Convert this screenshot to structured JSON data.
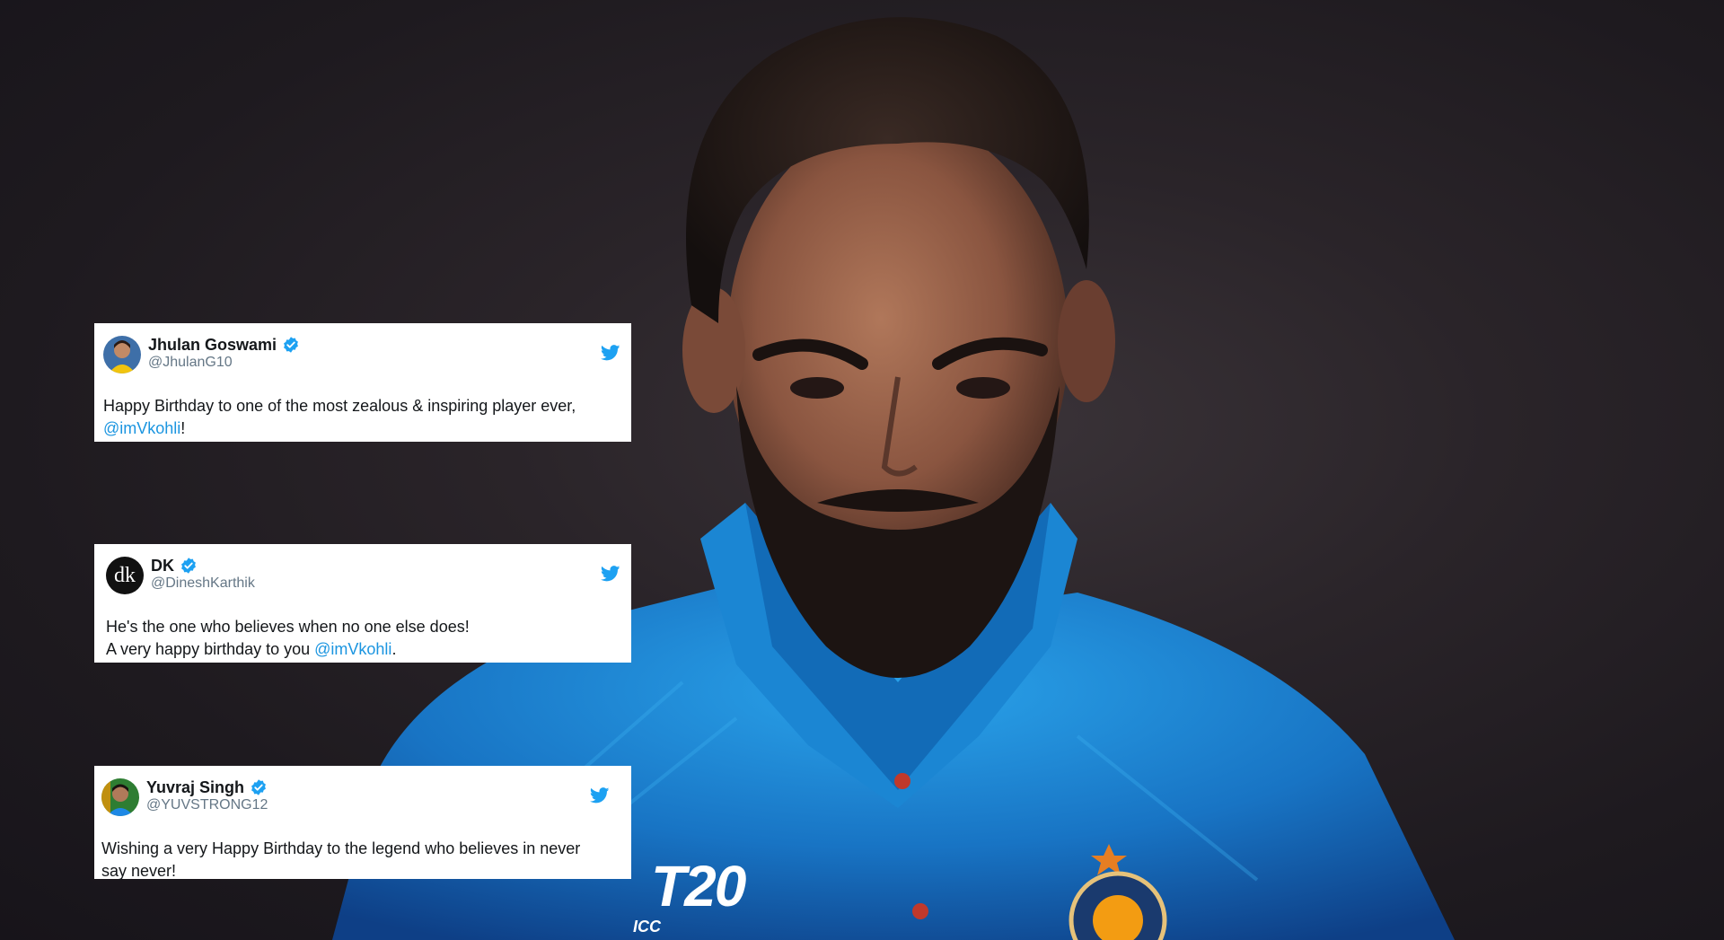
{
  "tweets": [
    {
      "display_name": "Jhulan Goswami",
      "handle": "@JhulanG10",
      "text_before": "Happy Birthday to one of the most zealous & inspiring player ever,\n",
      "mention": "@imVkohli",
      "text_after": "!"
    },
    {
      "display_name": "DK",
      "handle": "@DineshKarthik",
      "avatar_text": "dk",
      "text_before": "He's the one who believes when no one else does!\nA very happy birthday to you ",
      "mention": "@imVkohli",
      "text_after": "."
    },
    {
      "display_name": "Yuvraj Singh",
      "handle": "@YUVSTRONG12",
      "text_before": "Wishing a very Happy Birthday to the legend who believes in never say never!",
      "mention": "",
      "text_after": ""
    }
  ],
  "jersey": {
    "logo_text": "T20",
    "sub_text": "ICC"
  },
  "colors": {
    "background": "#221d24",
    "jersey_blue": "#1e8fd8",
    "twitter_blue": "#1da1f2",
    "mention_blue": "#1b95e0",
    "verified_blue": "#1da1f2"
  },
  "icons": [
    "twitter-bird-icon",
    "verified-badge-icon"
  ]
}
